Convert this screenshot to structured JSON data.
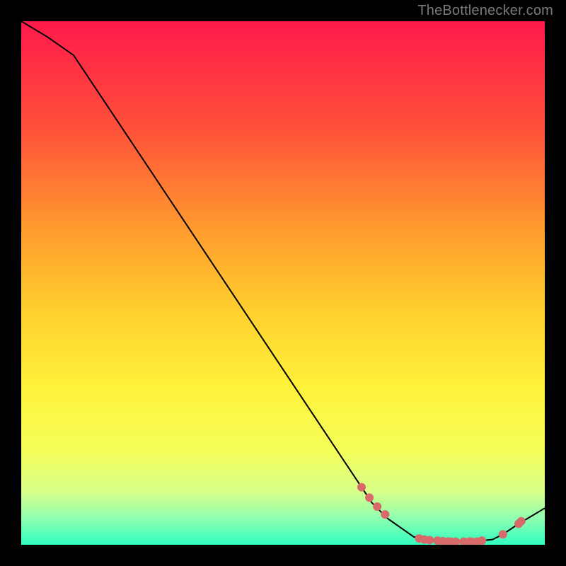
{
  "attribution": "TheBottlenecker.com",
  "chart_data": {
    "type": "line",
    "title": "",
    "xlabel": "",
    "ylabel": "",
    "xlim": [
      0,
      100
    ],
    "ylim": [
      0,
      100
    ],
    "x": [
      0,
      5,
      10,
      15,
      20,
      25,
      30,
      35,
      40,
      45,
      50,
      55,
      60,
      65,
      67,
      70,
      75,
      80,
      85,
      90,
      92,
      95,
      100
    ],
    "y": [
      100,
      97,
      93.5,
      86,
      78.5,
      71,
      63.5,
      56,
      48.5,
      41,
      33.5,
      26,
      18.5,
      11,
      8,
      5,
      1.5,
      0.7,
      0.5,
      1,
      2,
      4,
      7
    ],
    "markers": {
      "x": [
        65,
        66.5,
        68,
        69.5,
        76,
        77,
        78,
        79.5,
        80.5,
        81.5,
        82,
        83,
        84.5,
        85.5,
        86,
        87,
        88,
        92,
        95,
        95.5
      ],
      "y": [
        11,
        9,
        7.3,
        5.8,
        1.2,
        1.0,
        0.9,
        0.8,
        0.7,
        0.6,
        0.6,
        0.6,
        0.6,
        0.6,
        0.6,
        0.6,
        0.8,
        2,
        4,
        4.5
      ]
    },
    "background_gradient": {
      "stops": [
        {
          "offset": 0.0,
          "color": "#ff1a4b"
        },
        {
          "offset": 0.2,
          "color": "#ff4f3a"
        },
        {
          "offset": 0.4,
          "color": "#ff9c2e"
        },
        {
          "offset": 0.55,
          "color": "#ffcf2e"
        },
        {
          "offset": 0.7,
          "color": "#fff23a"
        },
        {
          "offset": 0.82,
          "color": "#f5ff5a"
        },
        {
          "offset": 0.9,
          "color": "#d7ff8a"
        },
        {
          "offset": 0.95,
          "color": "#8effb0"
        },
        {
          "offset": 1.0,
          "color": "#2fffc0"
        }
      ]
    },
    "line_color": "#000000",
    "marker_color": "#d86a6a"
  }
}
